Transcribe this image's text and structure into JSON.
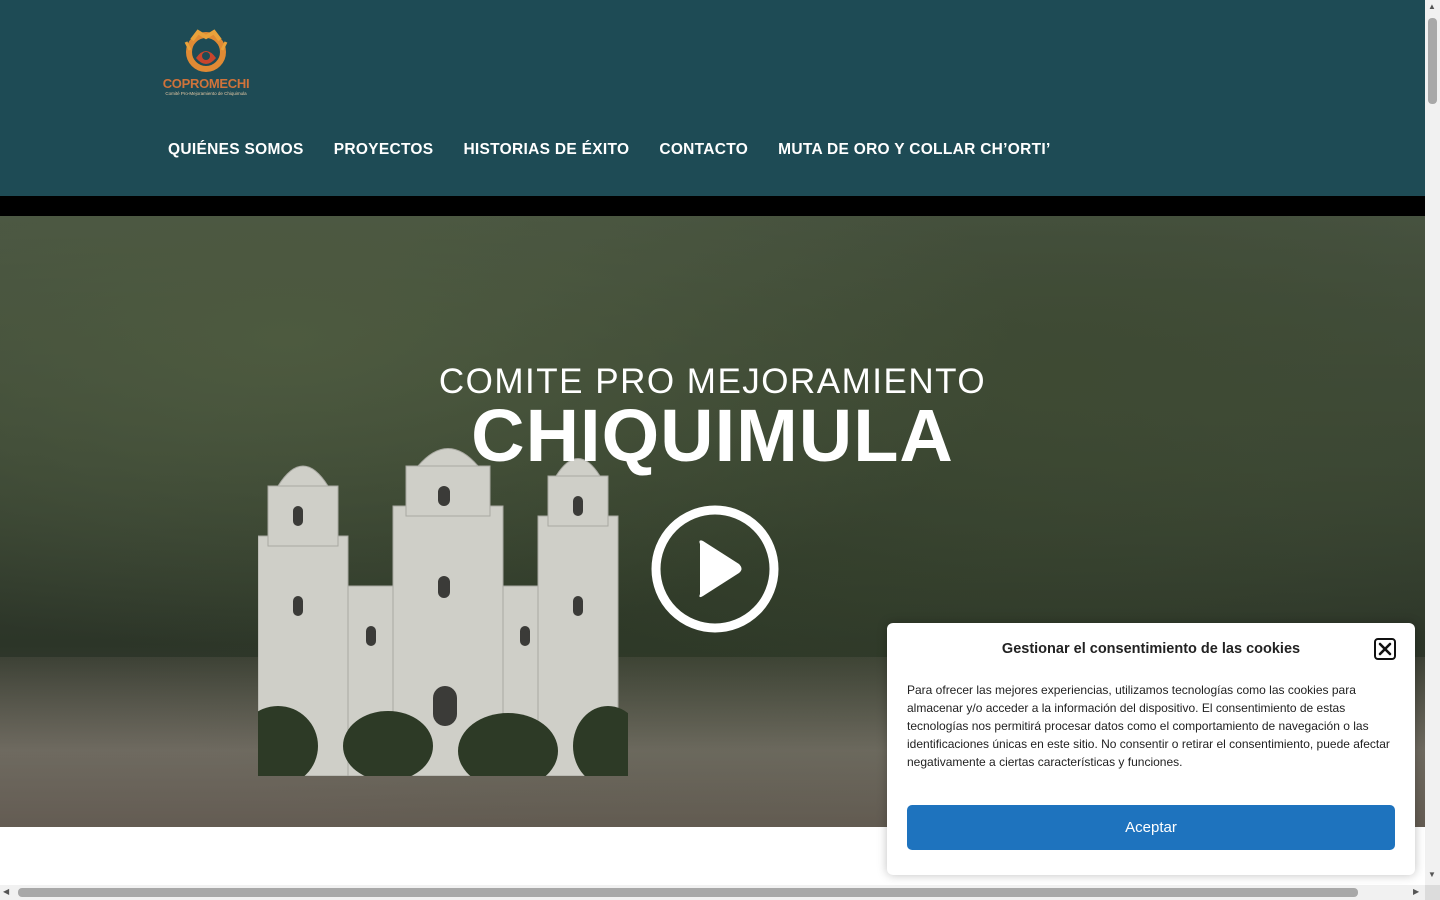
{
  "logo": {
    "name": "COPROMECHI",
    "subtitle": "Comité Pro-Mejoramiento de Chiquimula"
  },
  "nav": {
    "items": [
      {
        "label": "QUIÉNES SOMOS"
      },
      {
        "label": "PROYECTOS"
      },
      {
        "label": "HISTORIAS DE ÉXITO"
      },
      {
        "label": "CONTACTO"
      },
      {
        "label": "MUTA DE ORO Y COLLAR CH’ORTI’"
      }
    ]
  },
  "hero": {
    "subtitle": "COMITE PRO MEJORAMIENTO",
    "title": "CHIQUIMULA",
    "play_icon": "play-circle-icon"
  },
  "cookie_dialog": {
    "title": "Gestionar el consentimiento de las cookies",
    "body": "Para ofrecer las mejores experiencias, utilizamos tecnologías como las cookies para almacenar y/o acceder a la información del dispositivo. El consentimiento de estas tecnologías nos permitirá procesar datos como el comportamiento de navegación o las identificaciones únicas en este sitio. No consentir o retirar el consentimiento, puede afectar negativamente a ciertas características y funciones.",
    "accept_label": "Aceptar",
    "close_icon": "close-icon"
  },
  "colors": {
    "header_bg": "#1e4b55",
    "accent_button": "#1e73be",
    "logo_orange": "#d0733a"
  }
}
